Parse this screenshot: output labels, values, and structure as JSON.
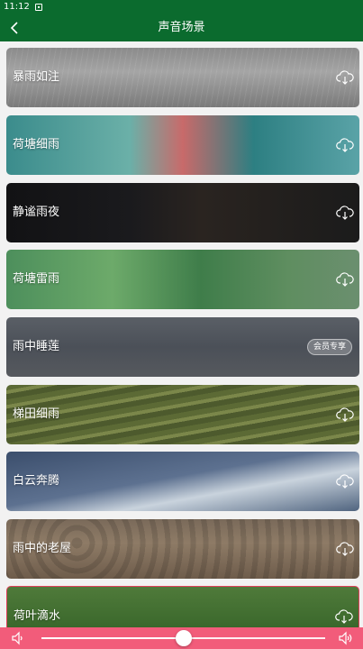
{
  "status": {
    "time": "11:12"
  },
  "header": {
    "title": "声音场景"
  },
  "scenes": [
    {
      "label": "暴雨如注",
      "action": "cloud-download-icon"
    },
    {
      "label": "荷塘细雨",
      "action": "cloud-download-icon"
    },
    {
      "label": "静谧雨夜",
      "action": "cloud-download-icon"
    },
    {
      "label": "荷塘雷雨",
      "action": "cloud-download-icon"
    },
    {
      "label": "雨中睡莲",
      "badge": "会员专享"
    },
    {
      "label": "梯田细雨",
      "action": "cloud-download-icon"
    },
    {
      "label": "白云奔腾",
      "action": "cloud-download-icon"
    },
    {
      "label": "雨中的老屋",
      "action": "cloud-download-icon"
    },
    {
      "label": "荷叶滴水",
      "action": "cloud-download-icon"
    }
  ],
  "player": {
    "volume": 0.5,
    "accent": "#f25c7a"
  },
  "colors": {
    "appbar": "#0b6b2e"
  }
}
